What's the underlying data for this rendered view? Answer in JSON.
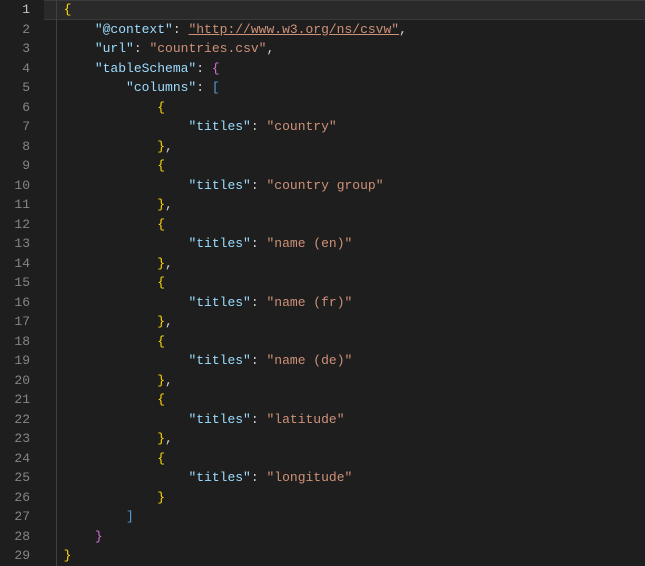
{
  "lineNumbers": [
    "1",
    "2",
    "3",
    "4",
    "5",
    "6",
    "7",
    "8",
    "9",
    "10",
    "11",
    "12",
    "13",
    "14",
    "15",
    "16",
    "17",
    "18",
    "19",
    "20",
    "21",
    "22",
    "23",
    "24",
    "25",
    "26",
    "27",
    "28",
    "29"
  ],
  "activeLine": 0,
  "code": {
    "keys": {
      "context": "\"@context\"",
      "url": "\"url\"",
      "tableSchema": "\"tableSchema\"",
      "columns": "\"columns\"",
      "titles": "\"titles\""
    },
    "values": {
      "contextUrl": "\"http://www.w3.org/ns/csvw\"",
      "url": "\"countries.csv\"",
      "col0": "\"country\"",
      "col1": "\"country group\"",
      "col2": "\"name (en)\"",
      "col3": "\"name (fr)\"",
      "col4": "\"name (de)\"",
      "col5": "\"latitude\"",
      "col6": "\"longitude\""
    },
    "punct": {
      "openBrace": "{",
      "closeBrace": "}",
      "openBracket": "[",
      "closeBracket": "]",
      "colon": ":",
      "comma": ","
    }
  }
}
